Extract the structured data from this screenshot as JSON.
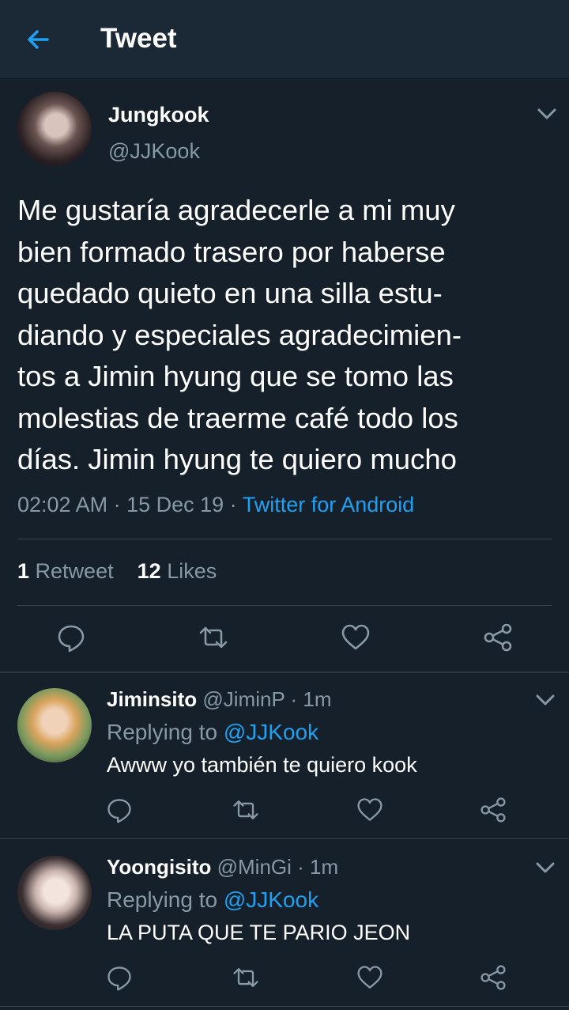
{
  "header": {
    "title": "Tweet"
  },
  "tweet": {
    "author_name": "Jungkook",
    "author_handle": "@JJKook",
    "text_lines": [
      "Me gustaría agradecerle a mi muy",
      "bien formado trasero por haberse",
      "quedado quieto en una silla estu-",
      "diando y especiales agradecimien-",
      "tos a Jimin hyung que se tomo las",
      "molestias de traerme café todo los",
      "días. Jimin hyung te quiero mucho"
    ],
    "time": "02:02 AM",
    "date": "15 Dec 19",
    "source": "Twitter for Android",
    "retweet_count": "1",
    "retweet_label": "Retweet",
    "like_count": "12",
    "like_label": "Likes"
  },
  "replies": [
    {
      "name": "Jiminsito",
      "handle": "@JiminP",
      "time": "1m",
      "replying_to_label": "Replying to",
      "replying_to_handle": "@JJKook",
      "text": "Awww yo también te quiero kook"
    },
    {
      "name": "Yoongisito",
      "handle": "@MinGi",
      "time": "1m",
      "replying_to_label": "Replying to",
      "replying_to_handle": "@JJKook",
      "text": "LA PUTA QUE TE PARIO JEON"
    }
  ],
  "icons": {
    "back": "arrow-left-icon",
    "reply": "reply-icon",
    "retweet": "retweet-icon",
    "like": "heart-icon",
    "share": "share-icon",
    "more": "chevron-down-icon"
  },
  "colors": {
    "background": "#15202b",
    "header": "#1b2836",
    "accent": "#1da1f2",
    "secondary_text": "#8899a6",
    "divider": "#38444d"
  }
}
